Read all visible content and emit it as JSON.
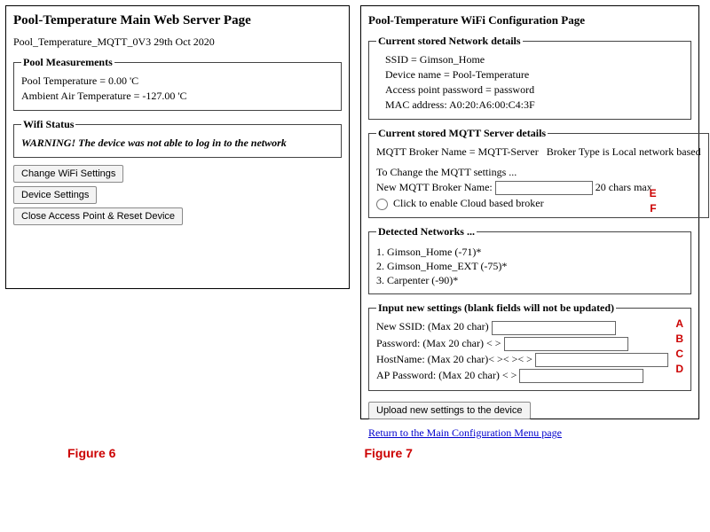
{
  "left": {
    "title": "Pool-Temperature Main Web Server Page",
    "subtitle": "Pool_Temperature_MQTT_0V3 29th Oct 2020",
    "measurements_legend": "Pool Measurements",
    "pool_temp_line": "Pool Temperature = 0.00 'C",
    "ambient_line": "Ambient Air Temperature = -127.00 'C",
    "wifi_legend": "Wifi Status",
    "wifi_warning": "WARNING! The device was not able to log in to the network",
    "btn_change_wifi": "Change WiFi Settings",
    "btn_device_settings": "Device Settings",
    "btn_close_ap": "Close Access Point & Reset Device"
  },
  "right": {
    "title": "Pool-Temperature WiFi Configuration Page",
    "net_legend": "Current stored Network details",
    "net_ssid": "SSID = Gimson_Home",
    "net_device": "Device name = Pool-Temperature",
    "net_ap_pw": "Access point password = password",
    "net_mac": "MAC address: A0:20:A6:00:C4:3F",
    "mqtt_legend": "Current stored MQTT Server details",
    "mqtt_broker_line": "MQTT Broker Name = MQTT-Server   Broker Type is Local network based",
    "mqtt_change_hint": "To Change the MQTT settings ...",
    "mqtt_new_label": "New MQTT Broker Name:",
    "mqtt_max": "20 chars max",
    "mqtt_cloud_label": "Click to enable Cloud based broker",
    "detected_legend": "Detected Networks ...",
    "networks": {
      "n1": "Gimson_Home (-71)*",
      "n2": "Gimson_Home_EXT (-75)*",
      "n3": "Carpenter (-90)*"
    },
    "input_legend": "Input new settings (blank fields will not be updated)",
    "new_ssid_label": "New SSID: (Max 20 char)",
    "password_label": "Password: (Max 20 char) < >",
    "hostname_label": "HostName: (Max 20 char)< >< >< >",
    "ap_pw_label": "AP Password: (Max 20 char) < >",
    "btn_upload": "Upload new settings to the device",
    "return_link": "Return to the Main Configuration Menu page"
  },
  "markers": {
    "A": "A",
    "B": "B",
    "C": "C",
    "D": "D",
    "E": "E",
    "F": "F"
  },
  "figures": {
    "f6": "Figure 6",
    "f7": "Figure 7"
  }
}
